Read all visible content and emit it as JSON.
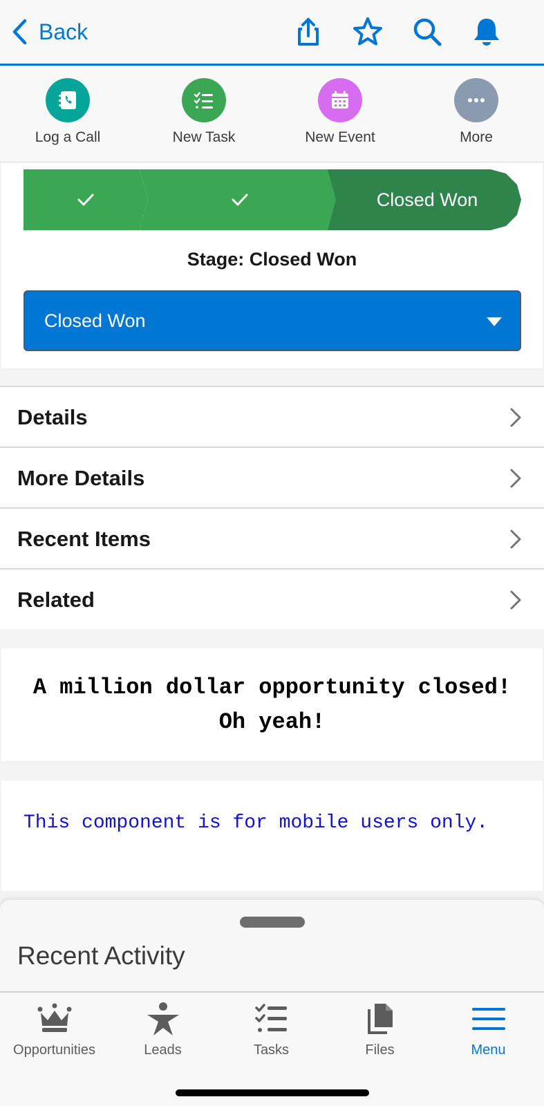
{
  "colors": {
    "brand": "#0176d3",
    "path_complete": "#3ba755",
    "path_current": "#2e844a",
    "log_call": "#06a59a",
    "new_task": "#3ba755",
    "new_event": "#d86cf0",
    "more": "#8a9bb0",
    "mobile_note_text": "#1010d8"
  },
  "header": {
    "back_label": "Back",
    "icons": [
      "share-icon",
      "star-icon",
      "search-icon",
      "bell-icon"
    ]
  },
  "actions": [
    {
      "label": "Log a Call",
      "icon": "call-log-icon"
    },
    {
      "label": "New Task",
      "icon": "task-list-icon"
    },
    {
      "label": "New Event",
      "icon": "calendar-icon"
    },
    {
      "label": "More",
      "icon": "ellipsis-icon"
    }
  ],
  "path": {
    "steps": [
      {
        "status": "complete",
        "icon": "check-icon"
      },
      {
        "status": "complete",
        "icon": "check-icon"
      },
      {
        "status": "current",
        "label": "Closed Won"
      }
    ],
    "stage_label": "Stage: Closed Won",
    "select_value": "Closed Won"
  },
  "sections": [
    {
      "label": "Details"
    },
    {
      "label": "More Details"
    },
    {
      "label": "Recent Items"
    },
    {
      "label": "Related"
    }
  ],
  "cards": {
    "celebration": "A million dollar opportunity closed! Oh yeah!",
    "mobile_note": "This component is for mobile users only."
  },
  "sheet": {
    "title": "Recent Activity"
  },
  "tabs": [
    {
      "label": "Opportunities",
      "icon": "crown-icon",
      "active": false
    },
    {
      "label": "Leads",
      "icon": "person-star-icon",
      "active": false
    },
    {
      "label": "Tasks",
      "icon": "task-list-icon",
      "active": false
    },
    {
      "label": "Files",
      "icon": "files-icon",
      "active": false
    },
    {
      "label": "Menu",
      "icon": "hamburger-icon",
      "active": true
    }
  ]
}
